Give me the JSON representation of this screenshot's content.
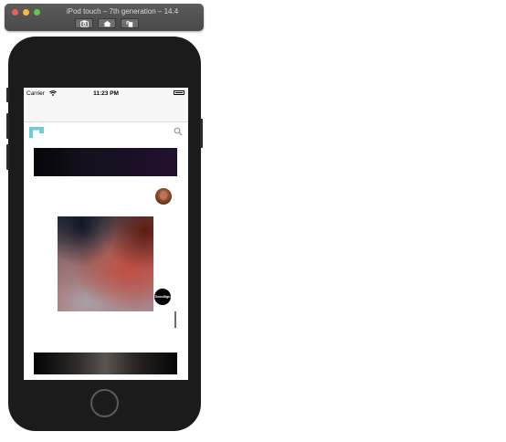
{
  "window": {
    "title": "iPod touch – 7th generation – 14.4",
    "toolbar": {
      "screenshot_icon": "camera-icon",
      "home_icon": "home-icon",
      "rotate_icon": "rotate-icon"
    }
  },
  "device": {
    "statusbar": {
      "carrier": "Carrier",
      "time": "11:23 PM",
      "battery_level": 1.0
    },
    "app": {
      "logo_icon": "logo-icon",
      "search_icon": "search-icon",
      "badge_text": "DocuSign"
    }
  },
  "colors": {
    "logo": "#6dcfd6",
    "device_body": "#1b1b1c",
    "titlebar": "#505050"
  }
}
